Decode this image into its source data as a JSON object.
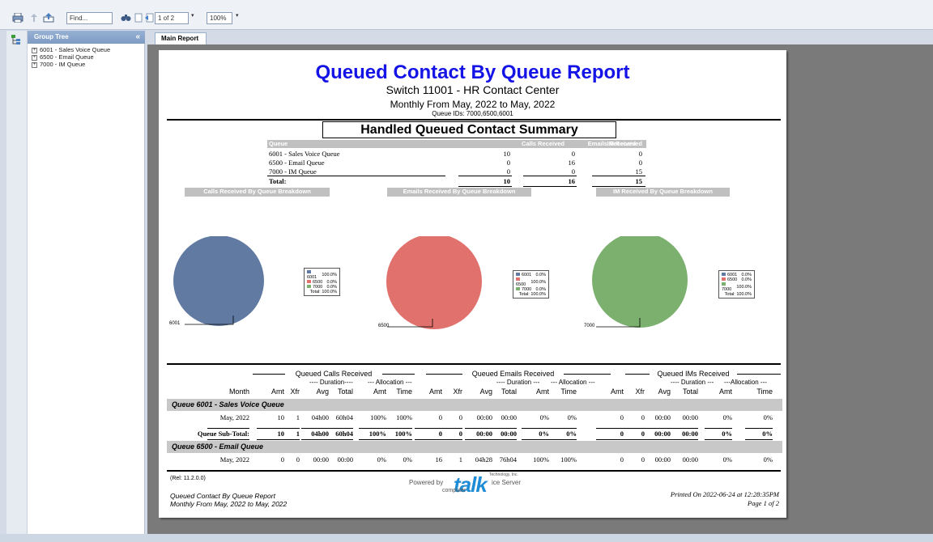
{
  "toolbar": {
    "find_placeholder": "Find...",
    "page_indicator": "1 of 2",
    "zoom": "100%"
  },
  "tree": {
    "header": "Group Tree",
    "collapse": "«",
    "items": [
      {
        "label": "6001 - Sales Voice Queue"
      },
      {
        "label": "6500 - Email Queue"
      },
      {
        "label": "7000 - IM Queue"
      }
    ]
  },
  "tabs": [
    {
      "label": "Main Report"
    }
  ],
  "report": {
    "title": "Queued Contact By Queue Report",
    "subtitle": "Switch 11001 - HR Contact Center",
    "period": "Monthly From May, 2022 to May, 2022",
    "queue_ids": "Queue IDs: 7000,6500,6001",
    "summary": {
      "title": "Handled Queued Contact Summary",
      "headers": [
        "Queue",
        "Calls Received",
        "Emails Received",
        "IM Received"
      ],
      "rows": [
        {
          "queue": "6001 - Sales Voice Queue",
          "calls": "10",
          "emails": "0",
          "im": "0"
        },
        {
          "queue": "6500 - Email Queue",
          "calls": "0",
          "emails": "16",
          "im": "0"
        },
        {
          "queue": "7000 - IM Queue",
          "calls": "0",
          "emails": "0",
          "im": "15"
        }
      ],
      "total": {
        "label": "Total:",
        "calls": "10",
        "emails": "16",
        "im": "15"
      }
    },
    "breakdowns": [
      {
        "title": "Calls Received By Queue Breakdown",
        "color": "#617aa2",
        "slice_label": "6001",
        "legend": [
          {
            "id": "6001",
            "pct": "100.0%",
            "color": "#617aa2"
          },
          {
            "id": "6500",
            "pct": "0.0%",
            "color": "#e0716c"
          },
          {
            "id": "7000",
            "pct": "0.0%",
            "color": "#7cb06e"
          }
        ],
        "total": "Total:  100.0%"
      },
      {
        "title": "Emails Received By Queue Breakdown",
        "color": "#e0716c",
        "slice_label": "6500",
        "legend": [
          {
            "id": "6001",
            "pct": "0.0%",
            "color": "#617aa2"
          },
          {
            "id": "6500",
            "pct": "100.0%",
            "color": "#e0716c"
          },
          {
            "id": "7000",
            "pct": "0.0%",
            "color": "#7cb06e"
          }
        ],
        "total": "Total:  100.0%"
      },
      {
        "title": "IM Received By Queue Breakdown",
        "color": "#7cb06e",
        "slice_label": "7000",
        "legend": [
          {
            "id": "6001",
            "pct": "0.0%",
            "color": "#617aa2"
          },
          {
            "id": "6500",
            "pct": "0.0%",
            "color": "#e0716c"
          },
          {
            "id": "7000",
            "pct": "100.0%",
            "color": "#7cb06e"
          }
        ],
        "total": "Total:  100.0%"
      }
    ],
    "detail": {
      "groups": [
        "Queued Calls Received",
        "Queued Emails Received",
        "Queued IMs Received"
      ],
      "duration_label": "---- Duration----",
      "alloc_label": "--- Allocation ---",
      "duration_label2": "---- Duration ---",
      "alloc_label2": "--- Allocation ---",
      "duration_label3": "---- Duration ---",
      "alloc_label3": "---Allocation ---",
      "columns": [
        "Month",
        "Amt",
        "Xfr",
        "Avg",
        "Total",
        "Amt",
        "Time",
        "Amt",
        "Xfr",
        "Avg",
        "Total",
        "Amt",
        "Time",
        "Amt",
        "Xfr",
        "Avg",
        "Total",
        "Amt",
        "Time"
      ],
      "queues": [
        {
          "name": "Queue 6001 - Sales Voice Queue",
          "row": [
            "May, 2022",
            "10",
            "1",
            "04h00",
            "60h04",
            "100%",
            "100%",
            "0",
            "0",
            "00:00",
            "00:00",
            "0%",
            "0%",
            "0",
            "0",
            "00:00",
            "00:00",
            "0%",
            "0%"
          ],
          "subtotal": [
            "Queue Sub-Total:",
            "10",
            "1",
            "04h00",
            "60h04",
            "100%",
            "100%",
            "0",
            "0",
            "00:00",
            "00:00",
            "0%",
            "0%",
            "0",
            "0",
            "00:00",
            "00:00",
            "0%",
            "0%"
          ]
        },
        {
          "name": "Queue 6500 - Email Queue",
          "row": [
            "May, 2022",
            "0",
            "0",
            "00:00",
            "00:00",
            "0%",
            "0%",
            "16",
            "1",
            "04h28",
            "76h04",
            "100%",
            "100%",
            "0",
            "0",
            "00:00",
            "00:00",
            "0%",
            "0%"
          ]
        }
      ]
    },
    "footer": {
      "rel": "(Rel: 11.2.0.0)",
      "powered_by": "Powered by",
      "logo_word": "talk",
      "logo_prefix": "computer",
      "logo_suffix": "Technology, Inc.",
      "logo_server": "ice Server",
      "report_name": "Queued Contact By Queue Report",
      "period": "Monthly From May, 2022 to May, 2022",
      "printed": "Printed On 2022-06-24 at 12:28:35PM",
      "page": "Page 1 of 2"
    }
  }
}
